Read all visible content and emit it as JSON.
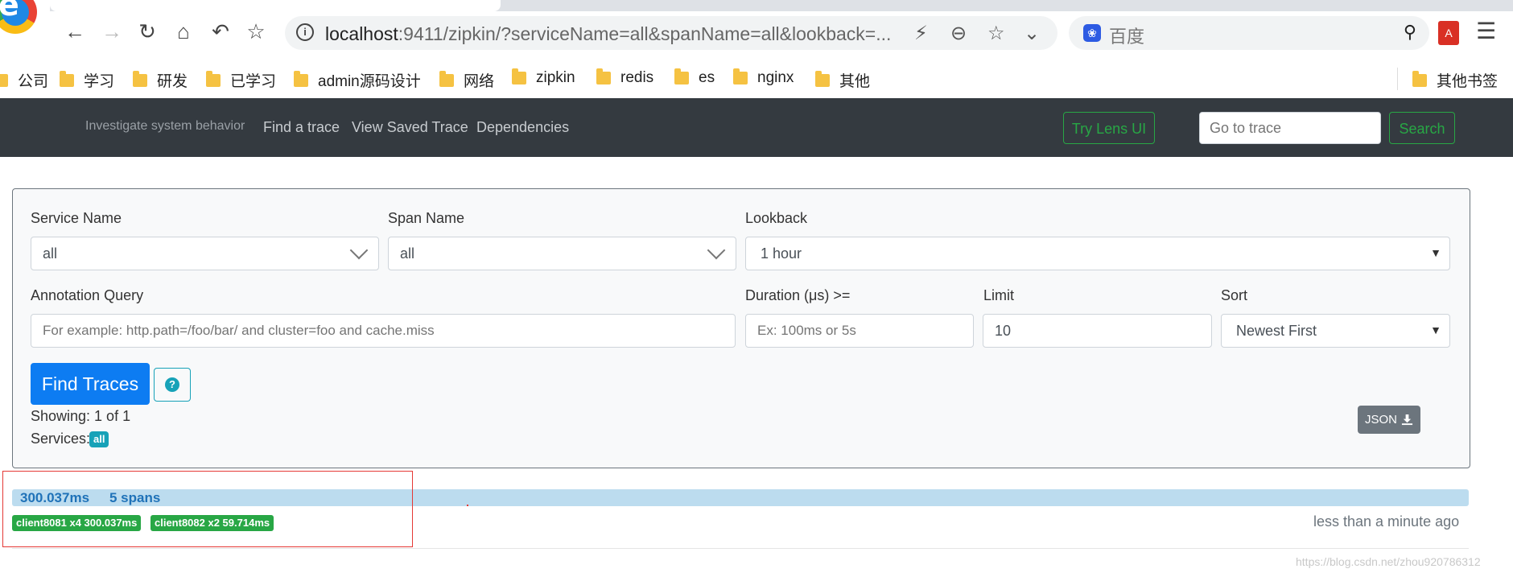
{
  "browser": {
    "url_host": "localhost",
    "url_rest": ":9411/zipkin/?serviceName=all&spanName=all&lookback=...",
    "search_placeholder": "百度",
    "bookmarks": [
      "公司",
      "学习",
      "研发",
      "已学习",
      "admin源码设计",
      "网络",
      "zipkin",
      "redis",
      "es",
      "nginx",
      "其他"
    ],
    "other_bookmarks": "其他书签"
  },
  "navbar": {
    "tagline": "Investigate system behavior",
    "links": [
      "Find a trace",
      "View Saved Trace",
      "Dependencies"
    ],
    "lens_button": "Try Lens UI",
    "goto_placeholder": "Go to trace",
    "search_button": "Search"
  },
  "form": {
    "service_name": {
      "label": "Service Name",
      "value": "all"
    },
    "span_name": {
      "label": "Span Name",
      "value": "all"
    },
    "lookback": {
      "label": "Lookback",
      "value": "1 hour"
    },
    "annotation_query": {
      "label": "Annotation Query",
      "placeholder": "For example: http.path=/foo/bar/ and cluster=foo and cache.miss"
    },
    "duration": {
      "label": "Duration (μs) >=",
      "placeholder": "Ex: 100ms or 5s"
    },
    "limit": {
      "label": "Limit",
      "value": "10"
    },
    "sort": {
      "label": "Sort",
      "value": "Newest First"
    },
    "find_button": "Find Traces",
    "help_icon": "question-circle-icon",
    "showing": "Showing: 1 of 1",
    "services_label": "Services:",
    "services_badge": "all",
    "json_button": "JSON",
    "json_icon": "download-icon"
  },
  "trace": {
    "duration": "300.037ms",
    "spans": "5 spans",
    "services": [
      "client8081 x4 300.037ms",
      "client8082 x2 59.714ms"
    ],
    "time_ago": "less than a minute ago"
  },
  "watermark": "https://blog.csdn.net/zhou920786312",
  "colors": {
    "navbar_bg": "#343a40",
    "primary": "#0d7cf2",
    "success": "#28a745",
    "info": "#17a2b8",
    "trace_bar": "#bcdcef",
    "highlight_box": "#e53935"
  }
}
